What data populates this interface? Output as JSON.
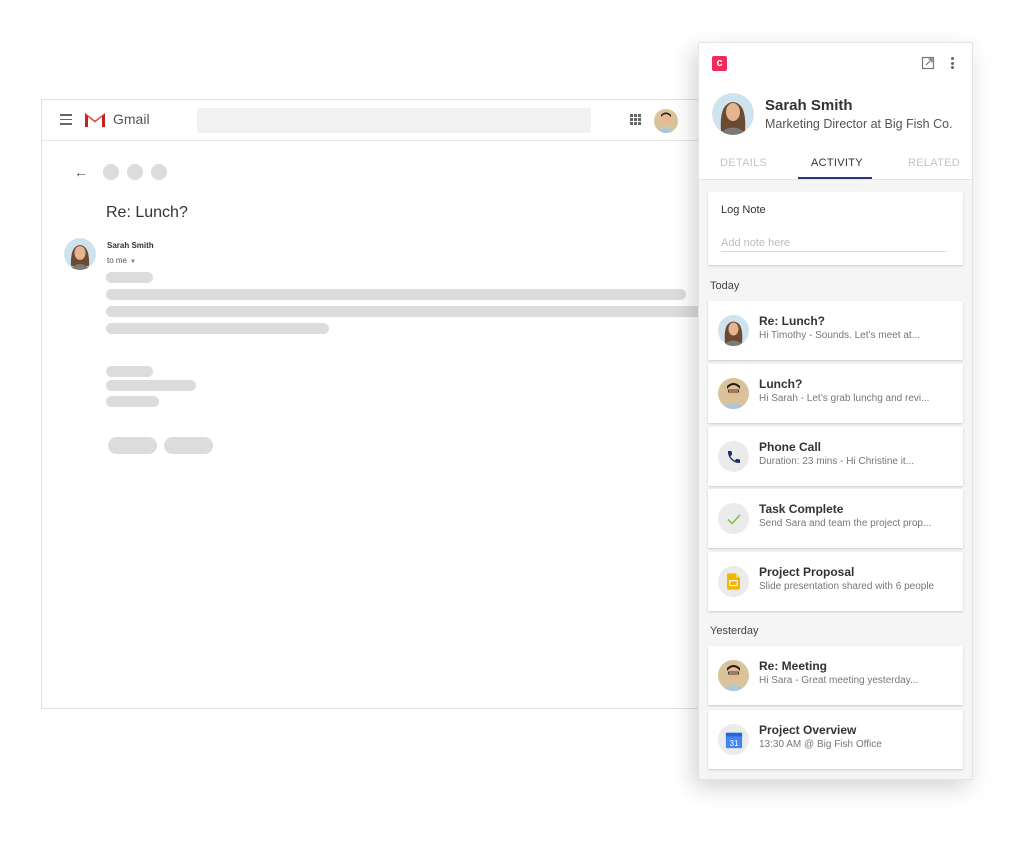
{
  "gmail": {
    "app_name": "Gmail",
    "search_placeholder": "",
    "icons": {
      "menu": "hamburger-menu-icon",
      "logo": "gmail-m-logo",
      "apps": "apps-grid-icon",
      "back": "arrow-left-icon"
    },
    "back_glyph": "←",
    "email": {
      "subject": "Re: Lunch?",
      "sender_name": "Sarah Smith",
      "recipient_label": "to me",
      "recipient_caret": "▼"
    }
  },
  "panel": {
    "brand_glyph": "c",
    "brand_color": "#f2295b",
    "icons": {
      "open_external": "open-in-new-icon",
      "more": "more-vertical-icon"
    },
    "contact": {
      "name": "Sarah Smith",
      "title": "Marketing Director at Big Fish Co."
    },
    "tabs": [
      {
        "label": "DETAILS",
        "active": false
      },
      {
        "label": "ACTIVITY",
        "active": true
      },
      {
        "label": "RELATED",
        "active": false
      }
    ],
    "accent_color": "#2d3382",
    "log_note": {
      "title": "Log Note",
      "placeholder": "Add note here",
      "value": ""
    },
    "sections": [
      {
        "label": "Today",
        "items": [
          {
            "icon": "avatar-sarah",
            "title": "Re: Lunch?",
            "subtitle": "Hi Timothy -  Sounds. Let’s meet at..."
          },
          {
            "icon": "avatar-timothy",
            "title": "Lunch?",
            "subtitle": "Hi Sarah - Let’s grab lunchg and revi..."
          },
          {
            "icon": "phone-icon",
            "title": "Phone Call",
            "subtitle": "Duration: 23 mins -  Hi Christine it..."
          },
          {
            "icon": "checkmark-icon",
            "title": "Task Complete",
            "subtitle": "Send Sara and team the project prop..."
          },
          {
            "icon": "google-slides-icon",
            "title": "Project Proposal",
            "subtitle": "Slide presentation shared with 6 people"
          }
        ]
      },
      {
        "label": "Yesterday",
        "items": [
          {
            "icon": "avatar-timothy",
            "title": "Re: Meeting",
            "subtitle": "Hi Sara - Great meeting yesterday..."
          },
          {
            "icon": "google-calendar-icon",
            "title": "Project Overview",
            "subtitle": "13:30 AM @ Big Fish Office",
            "calendar_day": "31"
          }
        ]
      }
    ]
  }
}
